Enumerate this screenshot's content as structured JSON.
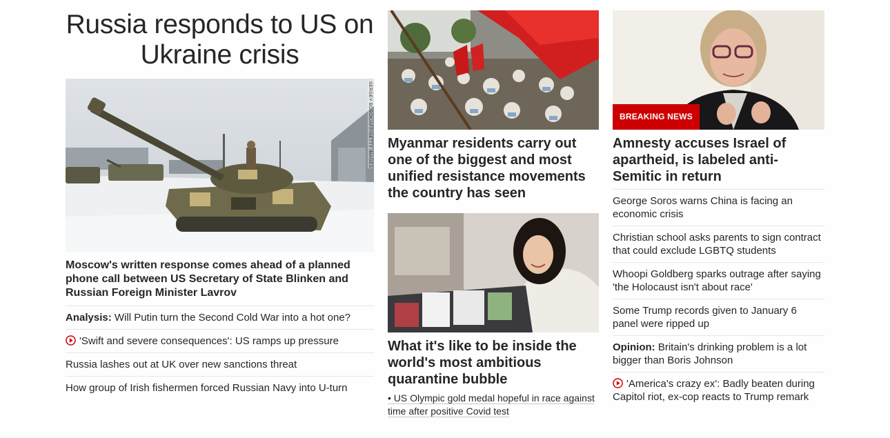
{
  "left": {
    "headline": "Russia responds to US on Ukraine crisis",
    "photo_credit": "SERGEY BOBOK/AFP/GETTY IMAGES",
    "lead_caption": "Moscow's written response comes ahead of a planned phone call between US Secretary of State Blinken and Russian Foreign Minister Lavrov",
    "items": [
      {
        "prefix": "Analysis:",
        "text": " Will Putin turn the Second Cold War into a hot one?"
      },
      {
        "icon": "play-icon",
        "text": "'Swift and severe consequences': US ramps up pressure"
      },
      {
        "text": "Russia lashes out at UK over new sanctions threat"
      },
      {
        "text": "How group of Irish fishermen forced Russian Navy into U-turn"
      }
    ]
  },
  "middle": {
    "story1": {
      "headline": "Myanmar residents carry out one of the biggest and most unified resistance movements the country has seen"
    },
    "story2": {
      "headline": "What it's like to be inside the world's most ambitious quarantine bubble",
      "sub_link": "• US Olympic gold medal hopeful in race against time after positive Covid test"
    }
  },
  "right": {
    "badge": "BREAKING NEWS",
    "headline": "Amnesty accuses Israel of apartheid, is labeled anti-Semitic in return",
    "items": [
      {
        "text": "George Soros warns China is facing an economic crisis"
      },
      {
        "text": "Christian school asks parents to sign contract that could exclude LGBTQ students"
      },
      {
        "text": "Whoopi Goldberg sparks outrage after saying 'the Holocaust isn't about race'"
      },
      {
        "text": "Some Trump records given to January 6 panel were ripped up"
      },
      {
        "prefix": "Opinion:",
        "text": " Britain's drinking problem is a lot bigger than Boris Johnson"
      },
      {
        "icon": "play-icon",
        "text": "'America's crazy ex': Badly beaten during Capitol riot, ex-cop reacts to Trump remark"
      }
    ]
  },
  "colors": {
    "breaking_red": "#cc0000",
    "text": "#262626",
    "divider": "#e6e6e6"
  }
}
